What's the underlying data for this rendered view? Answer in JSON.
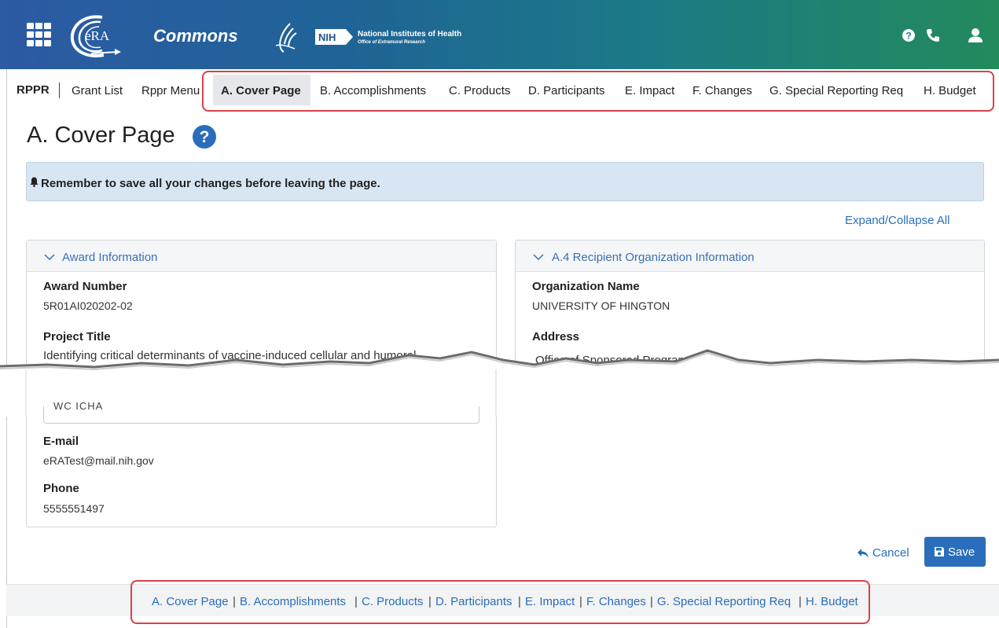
{
  "header": {
    "logo_text": "eRA",
    "app_name": "Commons",
    "nih_badge": "NIH",
    "nih_name": "National Institutes of Health",
    "nih_office": "Office of Extramural Research",
    "icons": [
      "apps-grid-icon",
      "help-icon",
      "phone-icon",
      "user-icon"
    ]
  },
  "topnav": {
    "root": "RPPR",
    "items": [
      "Grant List",
      "Rppr Menu",
      "A. Cover Page",
      "B. Accomplishments",
      "C. Products",
      "D. Participants",
      "E. Impact",
      "F. Changes",
      "G. Special Reporting Req",
      "H. Budget"
    ],
    "active": "A. Cover Page"
  },
  "page": {
    "title": "A. Cover Page",
    "alert": "Remember to save all your changes before leaving the page.",
    "expand_collapse": "Expand/Collapse All"
  },
  "award_card": {
    "title": "Award Information",
    "fields": [
      {
        "label": "Award Number",
        "value": "5R01AI020202-02"
      },
      {
        "label": "Project Title",
        "value": "Identifying critical determinants of vaccine-induced cellular and humoral"
      },
      {
        "label": "E-mail",
        "value": "eRATest@mail.nih.gov"
      },
      {
        "label": "Phone",
        "value": "5555551497"
      }
    ],
    "partial_input": "WC            ICHA"
  },
  "org_card": {
    "title": "A.4 Recipient Organization Information",
    "fields": [
      {
        "label": "Organization Name",
        "value": "UNIVERSITY OF HINGTON"
      },
      {
        "label": "Address",
        "value": "Office of Sponsored Programs"
      }
    ]
  },
  "actions": {
    "cancel": "Cancel",
    "save": "Save"
  },
  "footer": {
    "links": [
      "A. Cover Page",
      "B. Accomplishments",
      "C. Products",
      "D. Participants",
      "E. Impact",
      "F. Changes",
      "G. Special Reporting Req",
      "H. Budget"
    ],
    "separator": "|"
  },
  "colors": {
    "header_start": "#2c5aa3",
    "header_end": "#238a5c",
    "link": "#2a6ebb",
    "alert_bg": "#d8e6f3",
    "highlight_box": "#d9404a"
  }
}
